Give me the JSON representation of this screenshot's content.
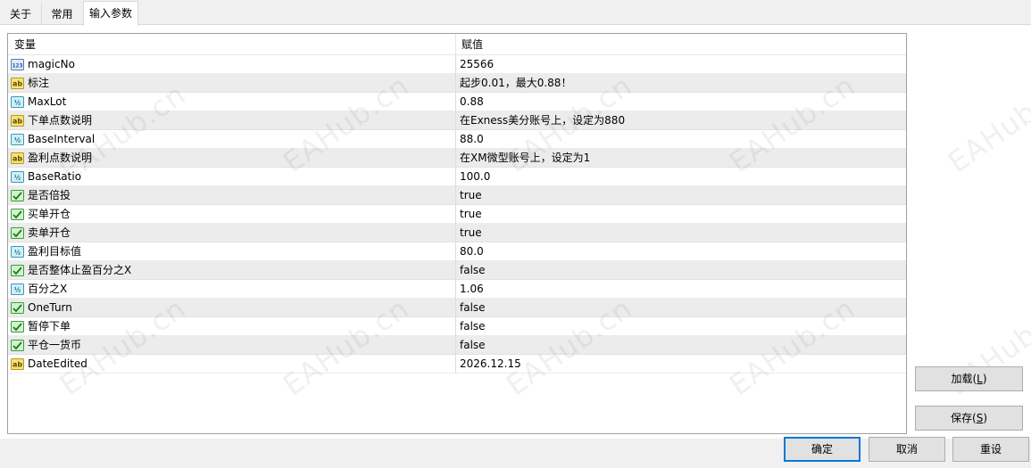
{
  "tabs": [
    {
      "label": "关于",
      "active": false
    },
    {
      "label": "常用",
      "active": false
    },
    {
      "label": "输入参数",
      "active": true
    }
  ],
  "table": {
    "headers": {
      "variable": "变量",
      "value": "赋值"
    },
    "rows": [
      {
        "icon": "integer-type-icon",
        "name": "magicNo",
        "value": "25566"
      },
      {
        "icon": "string-type-icon",
        "name": "标注",
        "value": "起步0.01，最大0.88！"
      },
      {
        "icon": "double-type-icon",
        "name": "MaxLot",
        "value": "0.88"
      },
      {
        "icon": "string-type-icon",
        "name": "下单点数说明",
        "value": "在Exness美分账号上，设定为880"
      },
      {
        "icon": "double-type-icon",
        "name": "BaseInterval",
        "value": "88.0"
      },
      {
        "icon": "string-type-icon",
        "name": "盈利点数说明",
        "value": "在XM微型账号上，设定为1"
      },
      {
        "icon": "double-type-icon",
        "name": "BaseRatio",
        "value": "100.0"
      },
      {
        "icon": "bool-type-icon",
        "name": "是否倍投",
        "value": "true"
      },
      {
        "icon": "bool-type-icon",
        "name": "买单开仓",
        "value": "true"
      },
      {
        "icon": "bool-type-icon",
        "name": "卖单开仓",
        "value": "true"
      },
      {
        "icon": "double-type-icon",
        "name": "盈利目标值",
        "value": "80.0"
      },
      {
        "icon": "bool-type-icon",
        "name": "是否整体止盈百分之X",
        "value": "false"
      },
      {
        "icon": "double-type-icon",
        "name": "百分之X",
        "value": "1.06"
      },
      {
        "icon": "bool-type-icon",
        "name": "OneTurn",
        "value": "false"
      },
      {
        "icon": "bool-type-icon",
        "name": "暂停下单",
        "value": "false"
      },
      {
        "icon": "bool-type-icon",
        "name": "平仓一货币",
        "value": "false"
      },
      {
        "icon": "string-type-icon",
        "name": "DateEdited",
        "value": "2026.12.15"
      }
    ]
  },
  "buttons": {
    "load": {
      "label": "加载(",
      "hotkey": "L",
      "suffix": ")"
    },
    "save": {
      "label": "保存(",
      "hotkey": "S",
      "suffix": ")"
    },
    "ok": "确定",
    "cancel": "取消",
    "reset": "重设"
  },
  "watermark": "EAHub.cn",
  "colors": {
    "primary_border": "#0078d7",
    "row_alt": "#ececec",
    "button_bg": "#e1e1e1"
  }
}
